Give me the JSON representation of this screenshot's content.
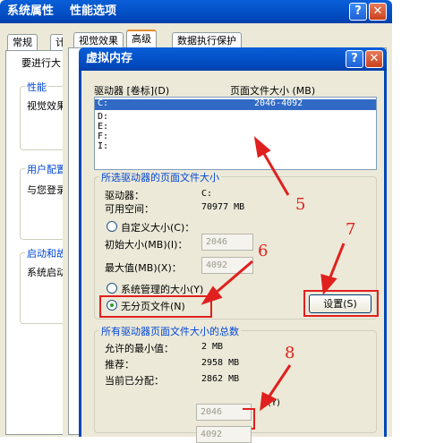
{
  "win1": {
    "title": "系统属性",
    "tab_general": "常规",
    "tab_cut": "计",
    "text_cut": "要进行大",
    "group_perf": "性能",
    "group_perf_text": "视觉效果",
    "group_profile": "用户配置",
    "group_profile_text": "与您登录",
    "group_startup": "启动和故",
    "group_startup_text": "系统启动"
  },
  "win2": {
    "title": "性能选项",
    "tabs": [
      "视觉效果",
      "高级",
      "数据执行保护"
    ]
  },
  "dialog": {
    "title": "虚拟内存",
    "col_drive": "驱动器 [卷标](D)",
    "col_pagefile": "页面文件大小 (MB)",
    "drives": [
      {
        "drive": "C:",
        "size": "2046-4092"
      },
      {
        "drive": "D:",
        "size": ""
      },
      {
        "drive": "E:",
        "size": ""
      },
      {
        "drive": "F:",
        "size": ""
      },
      {
        "drive": "I:",
        "size": ""
      }
    ],
    "selected_group": "所选驱动器的页面文件大小",
    "drive_label": "驱动器：",
    "drive_value": "C:",
    "space_label": "可用空间：",
    "space_value": "70977 MB",
    "custom_size": "自定义大小(C)：",
    "initial_label": "初始大小(MB)(I)：",
    "initial_value": "2046",
    "max_label": "最大值(MB)(X)：",
    "max_value": "4092",
    "system_managed": "系统管理的大小(Y)",
    "no_paging": "无分页文件(N)",
    "set_button": "设置(S)",
    "total_group": "所有驱动器页面文件大小的总数",
    "min_label": "允许的最小值：",
    "min_value": "2 MB",
    "rec_label": "推荐：",
    "rec_value": "2958 MB",
    "cur_label": "当前已分配：",
    "cur_value": "2862 MB",
    "y_hint": "(Y)",
    "bottom_value1": "2046",
    "bottom_value2": "4092"
  },
  "annotations": {
    "n5": "5",
    "n6": "6",
    "n7": "7",
    "n8": "8",
    "color": "#e0201e"
  }
}
